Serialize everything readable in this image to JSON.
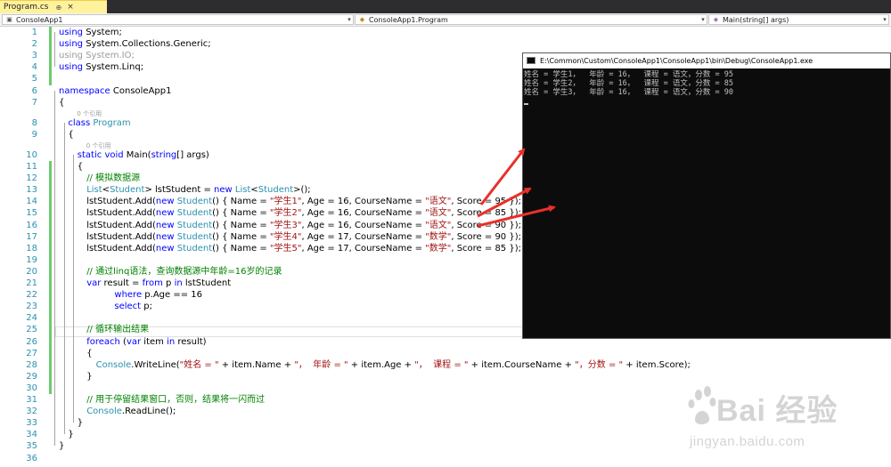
{
  "tab": {
    "name": "Program.cs",
    "pin": "⊕",
    "close": "×"
  },
  "navbar": {
    "project": "ConsoleApp1",
    "class_path": "ConsoleApp1.Program",
    "member": "Main(string[] args)"
  },
  "ref_hint": "0 个引用",
  "code": [
    {
      "n": "1",
      "indent": 0,
      "tokens": [
        [
          "kw",
          "using"
        ],
        [
          "",
          " System;"
        ]
      ]
    },
    {
      "n": "2",
      "indent": 0,
      "tokens": [
        [
          "kw",
          "using"
        ],
        [
          "",
          " System.Collections.Generic;"
        ]
      ]
    },
    {
      "n": "3",
      "indent": 0,
      "tokens": [
        [
          "dim",
          "using System.IO;"
        ]
      ]
    },
    {
      "n": "4",
      "indent": 0,
      "tokens": [
        [
          "kw",
          "using"
        ],
        [
          "",
          " System.Linq;"
        ]
      ]
    },
    {
      "n": "5",
      "indent": 0,
      "tokens": []
    },
    {
      "n": "6",
      "indent": 0,
      "tokens": [
        [
          "kw",
          "namespace"
        ],
        [
          "",
          " ConsoleApp1"
        ]
      ]
    },
    {
      "n": "7",
      "indent": 0,
      "tokens": [
        [
          "",
          "{"
        ]
      ]
    },
    {
      "n": "8",
      "indent": 1,
      "ref": true,
      "tokens": [
        [
          "kw",
          "class"
        ],
        [
          "",
          " "
        ],
        [
          "ty",
          "Program"
        ]
      ]
    },
    {
      "n": "9",
      "indent": 1,
      "tokens": [
        [
          "",
          "{"
        ]
      ]
    },
    {
      "n": "10",
      "indent": 2,
      "ref": true,
      "tokens": [
        [
          "kw",
          "static"
        ],
        [
          "",
          " "
        ],
        [
          "kw",
          "void"
        ],
        [
          "",
          " Main("
        ],
        [
          "kw",
          "string"
        ],
        [
          "",
          "[] args)"
        ]
      ]
    },
    {
      "n": "11",
      "indent": 2,
      "tokens": [
        [
          "",
          "{"
        ]
      ]
    },
    {
      "n": "12",
      "indent": 3,
      "tokens": [
        [
          "cm",
          "// 模拟数据源"
        ]
      ]
    },
    {
      "n": "13",
      "indent": 3,
      "tokens": [
        [
          "ty",
          "List"
        ],
        [
          "",
          "<"
        ],
        [
          "ty",
          "Student"
        ],
        [
          "",
          "> lstStudent = "
        ],
        [
          "kw",
          "new"
        ],
        [
          "",
          " "
        ],
        [
          "ty",
          "List"
        ],
        [
          "",
          "<"
        ],
        [
          "ty",
          "Student"
        ],
        [
          "",
          ">();"
        ]
      ]
    },
    {
      "n": "14",
      "indent": 3,
      "tokens": [
        [
          "",
          "lstStudent.Add("
        ],
        [
          "kw",
          "new"
        ],
        [
          "",
          " "
        ],
        [
          "ty",
          "Student"
        ],
        [
          "",
          "() { Name = "
        ],
        [
          "st",
          "\"学生1\""
        ],
        [
          "",
          ", Age = 16, CourseName = "
        ],
        [
          "st",
          "\"语文\""
        ],
        [
          "",
          ", Score = 95 });"
        ]
      ]
    },
    {
      "n": "15",
      "indent": 3,
      "tokens": [
        [
          "",
          "lstStudent.Add("
        ],
        [
          "kw",
          "new"
        ],
        [
          "",
          " "
        ],
        [
          "ty",
          "Student"
        ],
        [
          "",
          "() { Name = "
        ],
        [
          "st",
          "\"学生2\""
        ],
        [
          "",
          ", Age = 16, CourseName = "
        ],
        [
          "st",
          "\"语文\""
        ],
        [
          "",
          ", Score = 85 });"
        ]
      ]
    },
    {
      "n": "16",
      "indent": 3,
      "tokens": [
        [
          "",
          "lstStudent.Add("
        ],
        [
          "kw",
          "new"
        ],
        [
          "",
          " "
        ],
        [
          "ty",
          "Student"
        ],
        [
          "",
          "() { Name = "
        ],
        [
          "st",
          "\"学生3\""
        ],
        [
          "",
          ", Age = 16, CourseName = "
        ],
        [
          "st",
          "\"语文\""
        ],
        [
          "",
          ", Score = 90 });"
        ]
      ]
    },
    {
      "n": "17",
      "indent": 3,
      "tokens": [
        [
          "",
          "lstStudent.Add("
        ],
        [
          "kw",
          "new"
        ],
        [
          "",
          " "
        ],
        [
          "ty",
          "Student"
        ],
        [
          "",
          "() { Name = "
        ],
        [
          "st",
          "\"学生4\""
        ],
        [
          "",
          ", Age = 17, CourseName = "
        ],
        [
          "st",
          "\"数学\""
        ],
        [
          "",
          ", Score = 90 });"
        ]
      ]
    },
    {
      "n": "18",
      "indent": 3,
      "tokens": [
        [
          "",
          "lstStudent.Add("
        ],
        [
          "kw",
          "new"
        ],
        [
          "",
          " "
        ],
        [
          "ty",
          "Student"
        ],
        [
          "",
          "() { Name = "
        ],
        [
          "st",
          "\"学生5\""
        ],
        [
          "",
          ", Age = 17, CourseName = "
        ],
        [
          "st",
          "\"数学\""
        ],
        [
          "",
          ", Score = 85 });"
        ]
      ]
    },
    {
      "n": "19",
      "indent": 0,
      "tokens": []
    },
    {
      "n": "20",
      "indent": 3,
      "tokens": [
        [
          "cm",
          "// 通过linq语法，查询数据源中年龄=16岁的记录"
        ]
      ]
    },
    {
      "n": "21",
      "indent": 3,
      "tokens": [
        [
          "kw",
          "var"
        ],
        [
          "",
          " result = "
        ],
        [
          "kw",
          "from"
        ],
        [
          "",
          " p "
        ],
        [
          "kw",
          "in"
        ],
        [
          "",
          " lstStudent"
        ]
      ]
    },
    {
      "n": "22",
      "indent": 6,
      "tokens": [
        [
          "kw",
          "where"
        ],
        [
          "",
          " p.Age == 16"
        ]
      ]
    },
    {
      "n": "23",
      "indent": 6,
      "tokens": [
        [
          "kw",
          "select"
        ],
        [
          "",
          " p;"
        ]
      ]
    },
    {
      "n": "24",
      "indent": 0,
      "tokens": []
    },
    {
      "n": "25",
      "indent": 3,
      "tokens": [
        [
          "cm",
          "// 循环输出结果"
        ]
      ]
    },
    {
      "n": "26",
      "indent": 3,
      "tokens": [
        [
          "kw",
          "foreach"
        ],
        [
          "",
          " ("
        ],
        [
          "kw",
          "var"
        ],
        [
          "",
          " item "
        ],
        [
          "kw",
          "in"
        ],
        [
          "",
          " result)"
        ]
      ]
    },
    {
      "n": "27",
      "indent": 3,
      "tokens": [
        [
          "",
          "{"
        ]
      ]
    },
    {
      "n": "28",
      "indent": 4,
      "tokens": [
        [
          "ty",
          "Console"
        ],
        [
          "",
          ".WriteLine("
        ],
        [
          "st",
          "\"姓名 = \""
        ],
        [
          "",
          " + item.Name + "
        ],
        [
          "st",
          "\"，  年龄 = \""
        ],
        [
          "",
          " + item.Age + "
        ],
        [
          "st",
          "\"，  课程 = \""
        ],
        [
          "",
          " + item.CourseName + "
        ],
        [
          "st",
          "\"，分数 = \""
        ],
        [
          "",
          " + item.Score);"
        ]
      ]
    },
    {
      "n": "29",
      "indent": 3,
      "tokens": [
        [
          "",
          "}"
        ]
      ]
    },
    {
      "n": "30",
      "indent": 0,
      "tokens": []
    },
    {
      "n": "31",
      "indent": 3,
      "tokens": [
        [
          "cm",
          "// 用于停留结果窗口，否则，结果将一闪而过"
        ]
      ]
    },
    {
      "n": "32",
      "indent": 3,
      "tokens": [
        [
          "ty",
          "Console"
        ],
        [
          "",
          ".ReadLine();"
        ]
      ]
    },
    {
      "n": "33",
      "indent": 2,
      "tokens": [
        [
          "",
          "}"
        ]
      ]
    },
    {
      "n": "34",
      "indent": 1,
      "tokens": [
        [
          "",
          "}"
        ]
      ]
    },
    {
      "n": "35",
      "indent": 0,
      "tokens": [
        [
          "",
          "}"
        ]
      ]
    },
    {
      "n": "36",
      "indent": 0,
      "tokens": []
    }
  ],
  "console": {
    "title": "E:\\Common\\Custom\\ConsoleApp1\\ConsoleApp1\\bin\\Debug\\ConsoleApp1.exe",
    "lines": [
      "姓名 = 学生1，  年龄 = 16，  课程 = 语文，分数 = 95",
      "姓名 = 学生2，  年龄 = 16，  课程 = 语文，分数 = 85",
      "姓名 = 学生3，  年龄 = 16，  课程 = 语文，分数 = 90"
    ]
  },
  "watermark": {
    "brand": "Bai  经验",
    "url": "jingyan.baidu.com"
  },
  "colors": {
    "accent_arrow": "#e8302a",
    "change_bar": "#6dcb6d",
    "line_number": "#2b91af"
  }
}
